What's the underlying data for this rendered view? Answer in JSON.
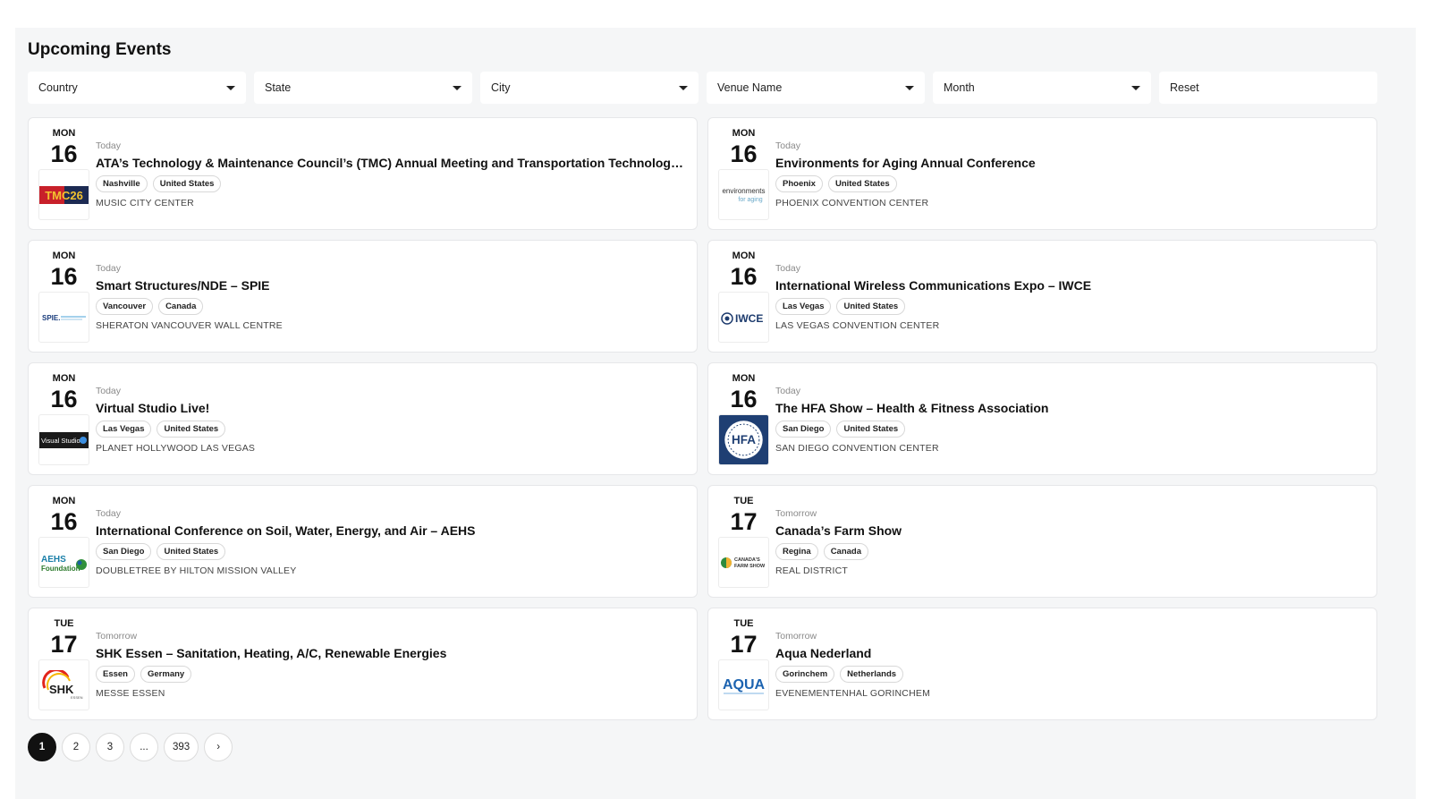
{
  "header": {
    "title": "Upcoming Events"
  },
  "filters": {
    "country": "Country",
    "state": "State",
    "city": "City",
    "venue": "Venue Name",
    "month": "Month",
    "reset": "Reset"
  },
  "events": [
    {
      "dow": "MON",
      "day": "16",
      "relative": "Today",
      "title": "ATA’s Technology & Maintenance Council’s (TMC) Annual Meeting and Transportation Technology E...",
      "city": "Nashville",
      "country": "United States",
      "venue": "MUSIC CITY CENTER",
      "logo": {
        "icon": "tmc26-logo",
        "text": "TMC26"
      }
    },
    {
      "dow": "MON",
      "day": "16",
      "relative": "Today",
      "title": "Environments for Aging Annual Conference",
      "city": "Phoenix",
      "country": "United States",
      "venue": "PHOENIX CONVENTION CENTER",
      "logo": {
        "icon": "environments-for-aging-logo",
        "text": "environments",
        "text2": "for aging"
      }
    },
    {
      "dow": "MON",
      "day": "16",
      "relative": "Today",
      "title": "Smart Structures/NDE – SPIE",
      "city": "Vancouver",
      "country": "Canada",
      "venue": "SHERATON VANCOUVER WALL CENTRE",
      "logo": {
        "icon": "spie-logo",
        "text": "SPIE."
      }
    },
    {
      "dow": "MON",
      "day": "16",
      "relative": "Today",
      "title": "International Wireless Communications Expo – IWCE",
      "city": "Las Vegas",
      "country": "United States",
      "venue": "LAS VEGAS CONVENTION CENTER",
      "logo": {
        "icon": "iwce-logo",
        "text": "IWCE"
      }
    },
    {
      "dow": "MON",
      "day": "16",
      "relative": "Today",
      "title": "Virtual Studio Live!",
      "city": "Las Vegas",
      "country": "United States",
      "venue": "PLANET HOLLYWOOD LAS VEGAS",
      "logo": {
        "icon": "visual-studio-logo",
        "text": "Visual Studio"
      }
    },
    {
      "dow": "MON",
      "day": "16",
      "relative": "Today",
      "title": "The HFA Show – Health & Fitness Association",
      "city": "San Diego",
      "country": "United States",
      "venue": "SAN DIEGO CONVENTION CENTER",
      "logo": {
        "icon": "hfa-logo",
        "text": "HFA"
      }
    },
    {
      "dow": "MON",
      "day": "16",
      "relative": "Today",
      "title": "International Conference on Soil, Water, Energy, and Air – AEHS",
      "city": "San Diego",
      "country": "United States",
      "venue": "DOUBLETREE BY HILTON MISSION VALLEY",
      "logo": {
        "icon": "aehs-foundation-logo",
        "text": "AEHS",
        "text2": "Foundation"
      }
    },
    {
      "dow": "TUE",
      "day": "17",
      "relative": "Tomorrow",
      "title": "Canada’s Farm Show",
      "city": "Regina",
      "country": "Canada",
      "venue": "REAL DISTRICT",
      "logo": {
        "icon": "canadas-farm-show-logo",
        "text": "CANADA'S",
        "text2": "FARM SHOW"
      }
    },
    {
      "dow": "TUE",
      "day": "17",
      "relative": "Tomorrow",
      "title": "SHK Essen – Sanitation, Heating, A/C, Renewable Energies",
      "city": "Essen",
      "country": "Germany",
      "venue": "MESSE ESSEN",
      "logo": {
        "icon": "shk-essen-logo",
        "text": "SHK",
        "text2": "ESSEN"
      }
    },
    {
      "dow": "TUE",
      "day": "17",
      "relative": "Tomorrow",
      "title": "Aqua Nederland",
      "city": "Gorinchem",
      "country": "Netherlands",
      "venue": "EVENEMENTENHAL GORINCHEM",
      "logo": {
        "icon": "aqua-logo",
        "text": "AQUA"
      }
    }
  ],
  "pagination": {
    "pages": [
      "1",
      "2",
      "3",
      "...",
      "393"
    ],
    "next": "›",
    "current": "1"
  }
}
